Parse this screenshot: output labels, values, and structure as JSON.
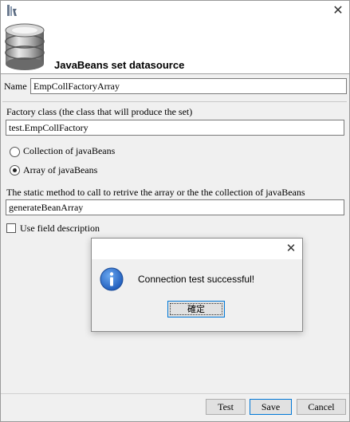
{
  "window": {
    "close_glyph": "✕"
  },
  "header": {
    "title": "JavaBeans set datasource",
    "icon": "database-icon"
  },
  "form": {
    "name_label": "Name",
    "name_value": "EmpCollFactoryArray",
    "factory_label": "Factory class (the class that will produce the set)",
    "factory_value": "test.EmpCollFactory",
    "radio_collection_label": "Collection of javaBeans",
    "radio_array_label": "Array of javaBeans",
    "selected_option": "Array of javaBeans",
    "method_label": "The static method to call to retrive the array or the the collection of javaBeans",
    "method_value": "generateBeanArray",
    "use_field_description_label": "Use field description",
    "use_field_description_checked": false
  },
  "footer": {
    "test_label": "Test",
    "save_label": "Save",
    "cancel_label": "Cancel"
  },
  "message_dialog": {
    "close_glyph": "✕",
    "icon": "info-icon",
    "message": "Connection test successful!",
    "ok_label": "確定"
  }
}
